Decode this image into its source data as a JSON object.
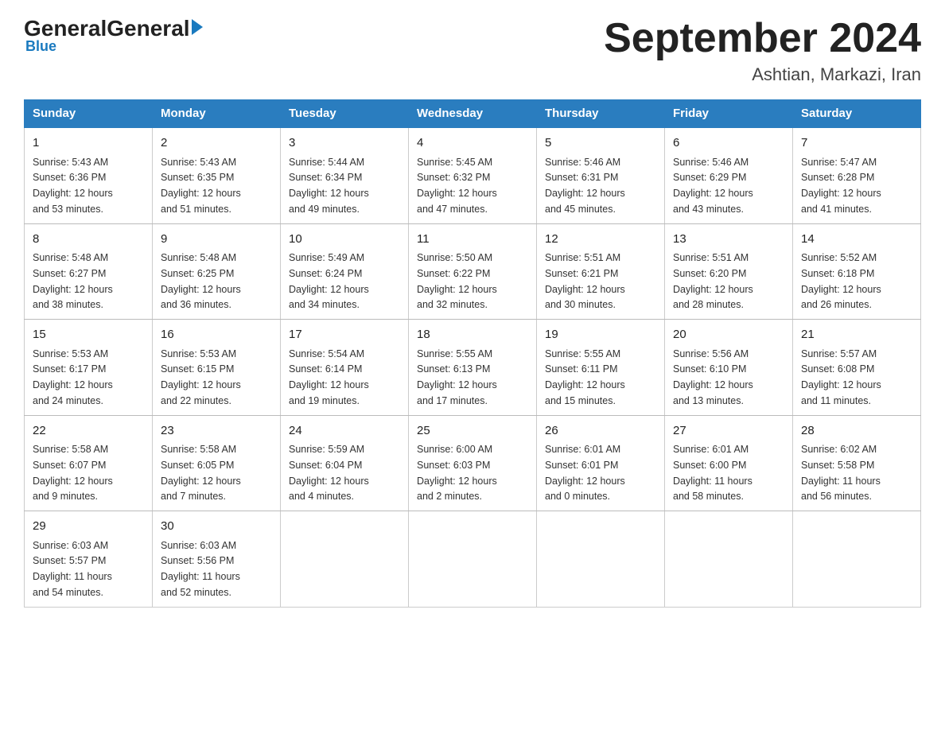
{
  "logo": {
    "general": "General",
    "blue": "Blue",
    "subtitle": "Blue"
  },
  "header": {
    "title": "September 2024",
    "location": "Ashtian, Markazi, Iran"
  },
  "days_of_week": [
    "Sunday",
    "Monday",
    "Tuesday",
    "Wednesday",
    "Thursday",
    "Friday",
    "Saturday"
  ],
  "weeks": [
    [
      {
        "num": "1",
        "sunrise": "5:43 AM",
        "sunset": "6:36 PM",
        "daylight": "12 hours and 53 minutes."
      },
      {
        "num": "2",
        "sunrise": "5:43 AM",
        "sunset": "6:35 PM",
        "daylight": "12 hours and 51 minutes."
      },
      {
        "num": "3",
        "sunrise": "5:44 AM",
        "sunset": "6:34 PM",
        "daylight": "12 hours and 49 minutes."
      },
      {
        "num": "4",
        "sunrise": "5:45 AM",
        "sunset": "6:32 PM",
        "daylight": "12 hours and 47 minutes."
      },
      {
        "num": "5",
        "sunrise": "5:46 AM",
        "sunset": "6:31 PM",
        "daylight": "12 hours and 45 minutes."
      },
      {
        "num": "6",
        "sunrise": "5:46 AM",
        "sunset": "6:29 PM",
        "daylight": "12 hours and 43 minutes."
      },
      {
        "num": "7",
        "sunrise": "5:47 AM",
        "sunset": "6:28 PM",
        "daylight": "12 hours and 41 minutes."
      }
    ],
    [
      {
        "num": "8",
        "sunrise": "5:48 AM",
        "sunset": "6:27 PM",
        "daylight": "12 hours and 38 minutes."
      },
      {
        "num": "9",
        "sunrise": "5:48 AM",
        "sunset": "6:25 PM",
        "daylight": "12 hours and 36 minutes."
      },
      {
        "num": "10",
        "sunrise": "5:49 AM",
        "sunset": "6:24 PM",
        "daylight": "12 hours and 34 minutes."
      },
      {
        "num": "11",
        "sunrise": "5:50 AM",
        "sunset": "6:22 PM",
        "daylight": "12 hours and 32 minutes."
      },
      {
        "num": "12",
        "sunrise": "5:51 AM",
        "sunset": "6:21 PM",
        "daylight": "12 hours and 30 minutes."
      },
      {
        "num": "13",
        "sunrise": "5:51 AM",
        "sunset": "6:20 PM",
        "daylight": "12 hours and 28 minutes."
      },
      {
        "num": "14",
        "sunrise": "5:52 AM",
        "sunset": "6:18 PM",
        "daylight": "12 hours and 26 minutes."
      }
    ],
    [
      {
        "num": "15",
        "sunrise": "5:53 AM",
        "sunset": "6:17 PM",
        "daylight": "12 hours and 24 minutes."
      },
      {
        "num": "16",
        "sunrise": "5:53 AM",
        "sunset": "6:15 PM",
        "daylight": "12 hours and 22 minutes."
      },
      {
        "num": "17",
        "sunrise": "5:54 AM",
        "sunset": "6:14 PM",
        "daylight": "12 hours and 19 minutes."
      },
      {
        "num": "18",
        "sunrise": "5:55 AM",
        "sunset": "6:13 PM",
        "daylight": "12 hours and 17 minutes."
      },
      {
        "num": "19",
        "sunrise": "5:55 AM",
        "sunset": "6:11 PM",
        "daylight": "12 hours and 15 minutes."
      },
      {
        "num": "20",
        "sunrise": "5:56 AM",
        "sunset": "6:10 PM",
        "daylight": "12 hours and 13 minutes."
      },
      {
        "num": "21",
        "sunrise": "5:57 AM",
        "sunset": "6:08 PM",
        "daylight": "12 hours and 11 minutes."
      }
    ],
    [
      {
        "num": "22",
        "sunrise": "5:58 AM",
        "sunset": "6:07 PM",
        "daylight": "12 hours and 9 minutes."
      },
      {
        "num": "23",
        "sunrise": "5:58 AM",
        "sunset": "6:05 PM",
        "daylight": "12 hours and 7 minutes."
      },
      {
        "num": "24",
        "sunrise": "5:59 AM",
        "sunset": "6:04 PM",
        "daylight": "12 hours and 4 minutes."
      },
      {
        "num": "25",
        "sunrise": "6:00 AM",
        "sunset": "6:03 PM",
        "daylight": "12 hours and 2 minutes."
      },
      {
        "num": "26",
        "sunrise": "6:01 AM",
        "sunset": "6:01 PM",
        "daylight": "12 hours and 0 minutes."
      },
      {
        "num": "27",
        "sunrise": "6:01 AM",
        "sunset": "6:00 PM",
        "daylight": "11 hours and 58 minutes."
      },
      {
        "num": "28",
        "sunrise": "6:02 AM",
        "sunset": "5:58 PM",
        "daylight": "11 hours and 56 minutes."
      }
    ],
    [
      {
        "num": "29",
        "sunrise": "6:03 AM",
        "sunset": "5:57 PM",
        "daylight": "11 hours and 54 minutes."
      },
      {
        "num": "30",
        "sunrise": "6:03 AM",
        "sunset": "5:56 PM",
        "daylight": "11 hours and 52 minutes."
      },
      null,
      null,
      null,
      null,
      null
    ]
  ],
  "labels": {
    "sunrise": "Sunrise:",
    "sunset": "Sunset:",
    "daylight": "Daylight:"
  }
}
